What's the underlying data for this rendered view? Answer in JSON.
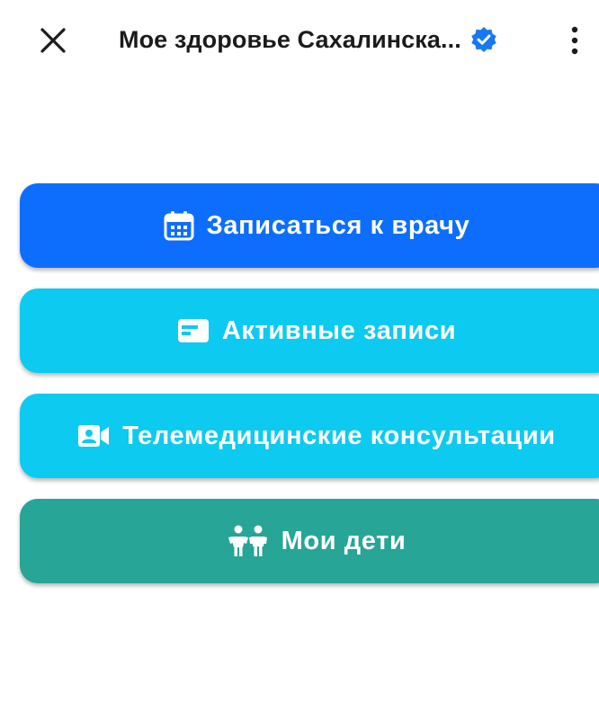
{
  "header": {
    "title": "Мое здоровье Сахалинска...",
    "close_icon": "close-icon",
    "verified_icon": "verified-badge-icon",
    "menu_icon": "more-vertical-icon"
  },
  "buttons": [
    {
      "label": "Записаться к врачу",
      "icon": "calendar-icon",
      "color": "#0d6efd"
    },
    {
      "label": "Активные записи",
      "icon": "card-icon",
      "color": "#0dcaf0"
    },
    {
      "label": "Телемедицинские консультации",
      "icon": "video-icon",
      "color": "#0dcaf0"
    },
    {
      "label": "Мои дети",
      "icon": "children-icon",
      "color": "#27a596"
    }
  ],
  "colors": {
    "verified": "#1877f2",
    "text": "#1b1b1b"
  }
}
